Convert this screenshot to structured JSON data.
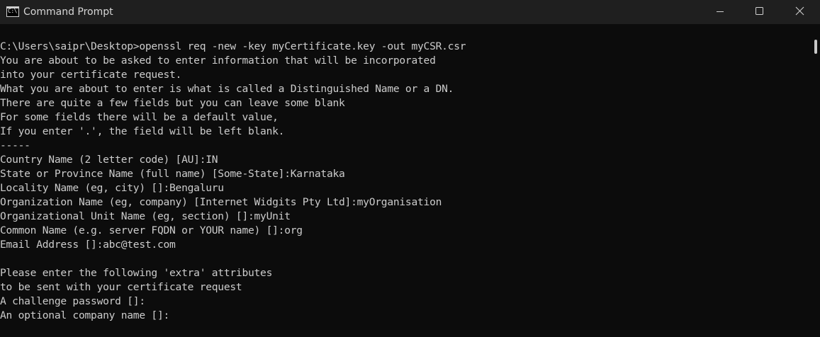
{
  "window": {
    "title": "Command Prompt",
    "app_icon": "cmd-icon",
    "app_icon_text": "C:\\",
    "buttons": {
      "minimize": "minimize-icon",
      "maximize": "maximize-icon",
      "close": "close-icon"
    }
  },
  "console": {
    "lines": [
      "C:\\Users\\saipr\\Desktop>openssl req -new -key myCertificate.key -out myCSR.csr",
      "You are about to be asked to enter information that will be incorporated",
      "into your certificate request.",
      "What you are about to enter is what is called a Distinguished Name or a DN.",
      "There are quite a few fields but you can leave some blank",
      "For some fields there will be a default value,",
      "If you enter '.', the field will be left blank.",
      "-----",
      "Country Name (2 letter code) [AU]:IN",
      "State or Province Name (full name) [Some-State]:Karnataka",
      "Locality Name (eg, city) []:Bengaluru",
      "Organization Name (eg, company) [Internet Widgits Pty Ltd]:myOrganisation",
      "Organizational Unit Name (eg, section) []:myUnit",
      "Common Name (e.g. server FQDN or YOUR name) []:org",
      "Email Address []:abc@test.com",
      "",
      "Please enter the following 'extra' attributes",
      "to be sent with your certificate request",
      "A challenge password []:",
      "An optional company name []:"
    ]
  },
  "colors": {
    "titlebar": "#1f1f1f",
    "background": "#0c0c0c",
    "text": "#cccccc"
  }
}
